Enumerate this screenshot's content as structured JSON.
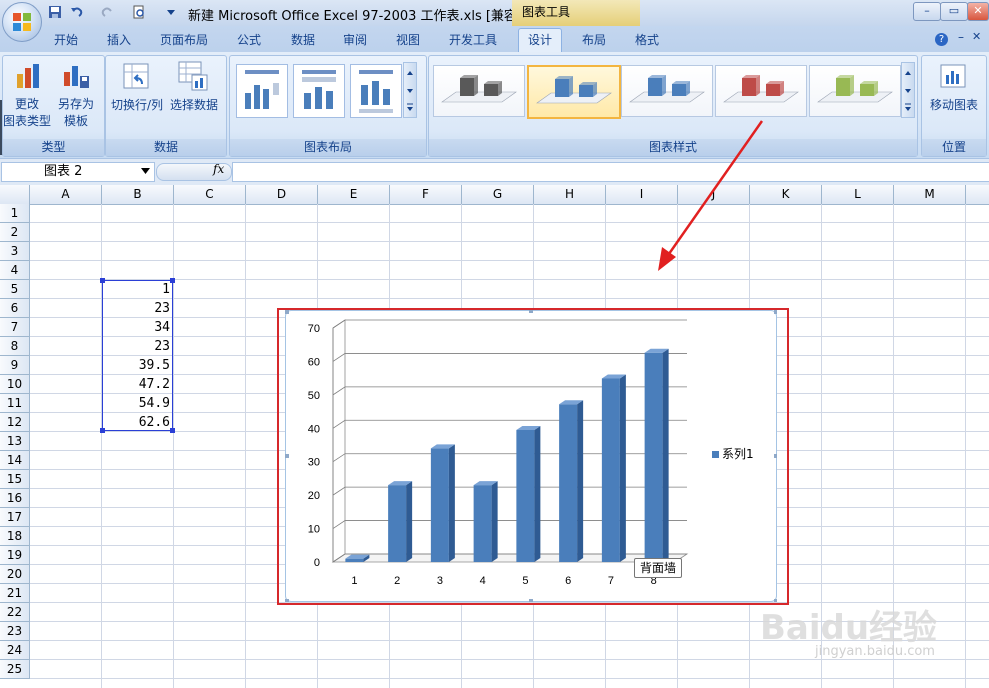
{
  "window": {
    "title": "新建 Microsoft Office Excel 97-2003 工作表.xls  [兼容...",
    "contextual_tab": "图表工具",
    "min_label": "–",
    "restore_label": "▭",
    "close_label": "✕"
  },
  "tabs": [
    "开始",
    "插入",
    "页面布局",
    "公式",
    "数据",
    "审阅",
    "视图",
    "开发工具",
    "设计",
    "布局",
    "格式"
  ],
  "active_tab": "设计",
  "ribbon": {
    "type_group": {
      "label": "类型",
      "change_type": [
        "更改",
        "图表类型"
      ],
      "save_template": [
        "另存为",
        "模板"
      ]
    },
    "data_group": {
      "label": "数据",
      "switch_row_col": "切换行/列",
      "select_data": "选择数据"
    },
    "layout_group": {
      "label": "图表布局"
    },
    "styles_group": {
      "label": "图表样式",
      "colors": [
        "#595959",
        "#4a7ebb",
        "#4a7ebb",
        "#be4b48",
        "#98b954"
      ]
    },
    "location_group": {
      "label": "位置",
      "move_chart": "移动图表"
    }
  },
  "formula_bar": {
    "name_box": "图表 2",
    "fx_label": "fx"
  },
  "columns": [
    "A",
    "B",
    "C",
    "D",
    "E",
    "F",
    "G",
    "H",
    "I",
    "J",
    "K",
    "L",
    "M"
  ],
  "rows": [
    "1",
    "2",
    "3",
    "4",
    "5",
    "6",
    "7",
    "8",
    "9",
    "10",
    "11",
    "12",
    "13",
    "14",
    "15",
    "16",
    "17",
    "18",
    "19",
    "20",
    "21",
    "22",
    "23",
    "24",
    "25"
  ],
  "cells_B": [
    "1",
    "23",
    "34",
    "23",
    "39.5",
    "47.2",
    "54.9",
    "62.6"
  ],
  "chart_data": {
    "type": "bar",
    "categories": [
      "1",
      "2",
      "3",
      "4",
      "5",
      "6",
      "7",
      "8"
    ],
    "series": [
      {
        "name": "系列1",
        "values": [
          1,
          23,
          34,
          23,
          39.5,
          47.2,
          54.9,
          62.6
        ],
        "color": "#4a7ebb"
      }
    ],
    "yticks": [
      "0",
      "10",
      "20",
      "30",
      "40",
      "50",
      "60",
      "70"
    ],
    "ylim": [
      0,
      70
    ],
    "grid": true,
    "legend": "right"
  },
  "tooltip": "背面墙",
  "watermark": {
    "main": "Baidu经验",
    "sub": "jingyan.baidu.com"
  }
}
